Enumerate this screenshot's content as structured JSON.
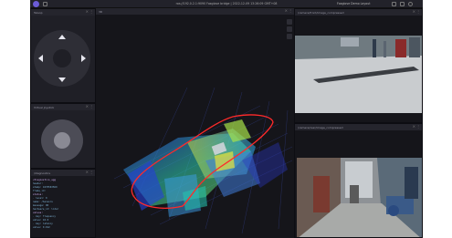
{
  "app": {
    "window_title": "ros://192.0.2.1:9090 Foxglove bridge | 2022-12-09 13:26:09 GMT+08",
    "layout_name": "Foxglove Demo Layout",
    "accent_color": "#6b5bd6"
  },
  "panels": {
    "teleop": {
      "title": "Teleop"
    },
    "joystick": {
      "title": "Virtual Joystick"
    },
    "diagnostics": {
      "title": "/diagnostics",
      "lines": [
        "/diagnostics_agg",
        "header:",
        "  stamp: 1670563569",
        "  frame_id:",
        "status:",
        "  - level: 0",
        "    name: /Sensors",
        "    message: OK",
        "    hardware_id: lidar",
        "  values:",
        "    - key: frequency",
        "      value: 10.0",
        "    - key: latency",
        "      value: 0.012",
        "  - level: 0",
        "    name: /Camera"
      ]
    },
    "viewport_3d": {
      "title": "3D"
    },
    "camera_front": {
      "title": "/camera/front/image_compressed"
    },
    "camera_rear": {
      "title": "/camera/rear/image_compressed"
    }
  },
  "icons": {
    "menu": "⋮",
    "close": "×"
  }
}
